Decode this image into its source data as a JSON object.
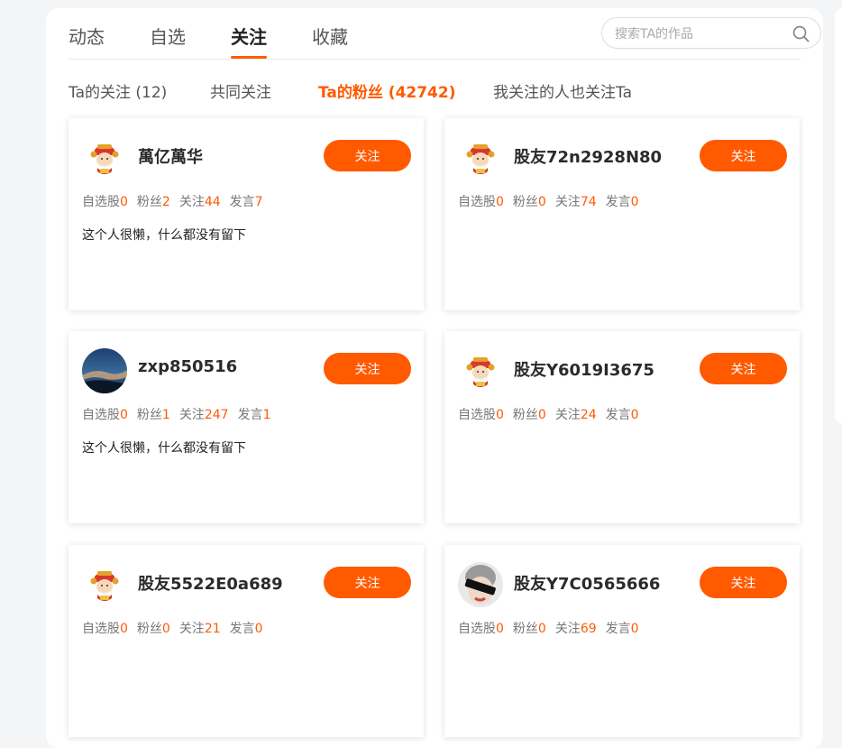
{
  "tabs": [
    {
      "label": "动态"
    },
    {
      "label": "自选"
    },
    {
      "label": "关注"
    },
    {
      "label": "收藏"
    }
  ],
  "active_tab": "关注",
  "search": {
    "placeholder": "搜索TA的作品",
    "icon": "search-icon"
  },
  "subtabs": [
    {
      "label": "Ta的关注 (12)"
    },
    {
      "label": "共同关注"
    },
    {
      "label": "Ta的粉丝 (42742)"
    },
    {
      "label": "我关注的人也关注Ta"
    }
  ],
  "active_subtab": "Ta的粉丝 (42742)",
  "colors": {
    "accent": "#ff5a00",
    "text": "#333333",
    "muted": "#777777"
  },
  "stat_labels": {
    "stocks": "自选股",
    "fans": "粉丝",
    "following": "关注",
    "posts": "发言"
  },
  "follow_label": "关注",
  "users": [
    {
      "name": "萬亿萬华",
      "avatar": "mascot-avatar",
      "stocks": "0",
      "fans": "2",
      "following": "44",
      "posts": "7",
      "bio": "这个人很懒，什么都没有留下"
    },
    {
      "name": "股友72n2928N80",
      "avatar": "mascot-avatar",
      "stocks": "0",
      "fans": "0",
      "following": "74",
      "posts": "0",
      "bio": ""
    },
    {
      "name": "zxp850516",
      "avatar": "sky-photo-avatar",
      "stocks": "0",
      "fans": "1",
      "following": "247",
      "posts": "1",
      "bio": "这个人很懒，什么都没有留下"
    },
    {
      "name": "股友Y6019I3675",
      "avatar": "mascot-avatar",
      "stocks": "0",
      "fans": "0",
      "following": "24",
      "posts": "0",
      "bio": ""
    },
    {
      "name": "股友5522E0a689",
      "avatar": "mascot-avatar",
      "stocks": "0",
      "fans": "0",
      "following": "21",
      "posts": "0",
      "bio": ""
    },
    {
      "name": "股友Y7C0565666",
      "avatar": "sunglasses-photo-avatar",
      "stocks": "0",
      "fans": "0",
      "following": "69",
      "posts": "0",
      "bio": ""
    }
  ]
}
